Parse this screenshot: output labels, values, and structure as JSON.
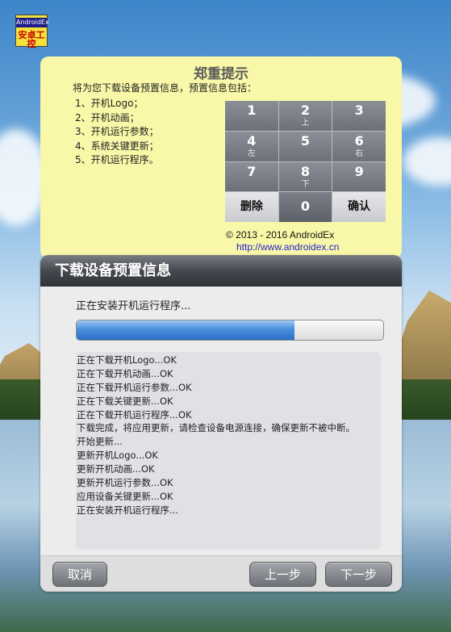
{
  "logo": {
    "line1": "AndroidEx",
    "line2": "安卓工控"
  },
  "notice": {
    "title": "郑重提示",
    "intro": "将为您下载设备预置信息，预置信息包括：",
    "items": [
      "1、开机Logo；",
      "2、开机动画；",
      "3、开机运行参数；",
      "4、系统关键更新；",
      "5、开机运行程序。"
    ],
    "copyright": "© 2013 - 2016 AndroidEx",
    "url": "http://www.androidex.cn"
  },
  "keypad": {
    "keys": [
      {
        "num": "1",
        "sub": ""
      },
      {
        "num": "2",
        "sub": "上"
      },
      {
        "num": "3",
        "sub": ""
      },
      {
        "num": "4",
        "sub": "左"
      },
      {
        "num": "5",
        "sub": ""
      },
      {
        "num": "6",
        "sub": "右"
      },
      {
        "num": "7",
        "sub": ""
      },
      {
        "num": "8",
        "sub": "下"
      },
      {
        "num": "9",
        "sub": ""
      },
      {
        "num": "删除",
        "sub": ""
      },
      {
        "num": "0",
        "sub": ""
      },
      {
        "num": "确认",
        "sub": ""
      }
    ]
  },
  "dialog": {
    "title": "下载设备预置信息",
    "status": "正在安装开机运行程序...",
    "progress": 0.71,
    "log": [
      "正在下载开机Logo...OK",
      "正在下载开机动画...OK",
      "正在下载开机运行参数...OK",
      "正在下载关键更新...OK",
      "正在下载开机运行程序...OK",
      "下载完成，将应用更新，请检查设备电源连接，确保更新不被中断。",
      "开始更新...",
      "更新开机Logo...OK",
      "更新开机动画...OK",
      "更新开机运行参数...OK",
      "应用设备关键更新...OK",
      "正在安装开机运行程序..."
    ],
    "buttons": {
      "cancel": "取消",
      "prev": "上一步",
      "next": "下一步"
    }
  },
  "colors": {
    "notice_bg": "#f9f8a8",
    "progress_blue": "#2b6fc6",
    "url": "#2222cc"
  }
}
